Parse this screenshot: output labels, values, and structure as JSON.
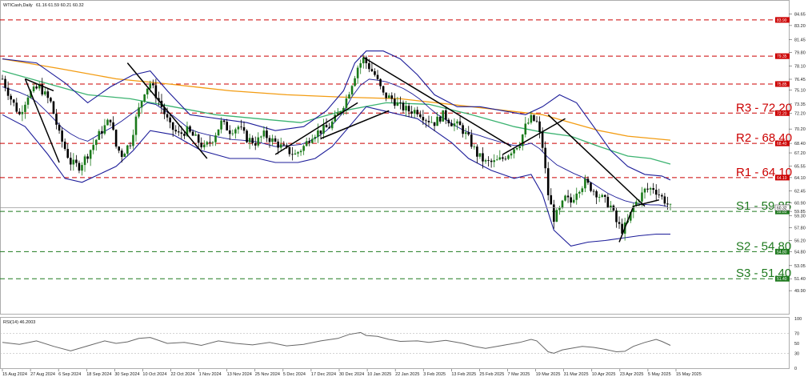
{
  "header": {
    "symbol": "WTICash,Daily",
    "ohlc": "61.16 61.59 60.21 60.32"
  },
  "rsi_header": "RSI(14) 46.2003",
  "colors": {
    "resistance": "#cc0000",
    "support": "#1f7a1f",
    "bull_candle": "#1a7a1a",
    "bear_candle": "#000000",
    "bollinger": "#1c1c99",
    "ma_fast": "#3cb371",
    "ma_slow": "#f39c12",
    "trendline": "#000000",
    "rsi_line": "#666666"
  },
  "chart_data": [
    {
      "type": "candlestick",
      "title": "",
      "xlabel": "",
      "ylabel": "",
      "ylim": [
        47.0,
        86.0
      ],
      "grid": false,
      "levels": [
        {
          "label": "R3 - 72.20",
          "value": 72.2,
          "kind": "resistance"
        },
        {
          "label": "R2 - 68.40",
          "value": 68.4,
          "kind": "resistance"
        },
        {
          "label": "R1 - 64.10",
          "value": 64.1,
          "kind": "resistance"
        },
        {
          "label": "S1 - 59.85",
          "value": 59.85,
          "kind": "support"
        },
        {
          "label": "S2 - 54.80",
          "value": 54.8,
          "kind": "support"
        },
        {
          "label": "S3 - 51.40",
          "value": 51.4,
          "kind": "support"
        }
      ],
      "extra_lines": [
        {
          "value": 83.9,
          "kind": "resistance"
        },
        {
          "value": 79.35,
          "kind": "resistance"
        },
        {
          "value": 75.85,
          "kind": "resistance"
        }
      ],
      "current_price": 60.32,
      "y_ticks": [
        "84.65",
        "83.20",
        "81.45",
        "79.80",
        "78.10",
        "76.45",
        "75.10",
        "73.35",
        "72.20",
        "70.20",
        "68.40",
        "67.20",
        "65.55",
        "64.10",
        "62.45",
        "60.90",
        "59.85",
        "59.30",
        "57.80",
        "56.20",
        "54.80",
        "53.05",
        "51.40",
        "49.90"
      ],
      "x_ticks": [
        "15 Aug 2024",
        "27 Aug 2024",
        "6 Sep 2024",
        "18 Sep 2024",
        "30 Sep 2024",
        "10 Oct 2024",
        "22 Oct 2024",
        "1 Nov 2024",
        "13 Nov 2024",
        "25 Nov 2024",
        "5 Dec 2024",
        "17 Dec 2024",
        "30 Dec 2024",
        "10 Jan 2025",
        "22 Jan 2025",
        "3 Feb 2025",
        "13 Feb 2025",
        "25 Feb 2025",
        "7 Mar 2025",
        "19 Mar 2025",
        "31 Mar 2025",
        "10 Apr 2025",
        "23 Apr 2025",
        "5 May 2025",
        "15 May 2025"
      ],
      "close_path": [
        [
          0,
          76.5
        ],
        [
          3,
          74.0
        ],
        [
          6,
          72.0
        ],
        [
          9,
          74.5
        ],
        [
          13,
          75.5
        ],
        [
          17,
          73.5
        ],
        [
          20,
          69.5
        ],
        [
          24,
          66.0
        ],
        [
          27,
          65.5
        ],
        [
          30,
          67.0
        ],
        [
          34,
          69.5
        ],
        [
          38,
          71.5
        ],
        [
          40,
          68.0
        ],
        [
          42,
          67.0
        ],
        [
          45,
          68.5
        ],
        [
          47,
          71.5
        ],
        [
          50,
          75.0
        ],
        [
          52,
          76.0
        ],
        [
          54,
          74.5
        ],
        [
          56,
          73.0
        ],
        [
          59,
          70.5
        ],
        [
          62,
          69.5
        ],
        [
          65,
          70.0
        ],
        [
          68,
          69.0
        ],
        [
          71,
          67.8
        ],
        [
          74,
          69.0
        ],
        [
          77,
          71.0
        ],
        [
          80,
          70.0
        ],
        [
          83,
          70.5
        ],
        [
          86,
          69.0
        ],
        [
          89,
          68.5
        ],
        [
          92,
          69.5
        ],
        [
          96,
          68.5
        ],
        [
          100,
          67.5
        ],
        [
          103,
          67.0
        ],
        [
          106,
          68.0
        ],
        [
          109,
          69.5
        ],
        [
          112,
          70.0
        ],
        [
          115,
          70.5
        ],
        [
          118,
          72.0
        ],
        [
          121,
          74.0
        ],
        [
          123,
          76.0
        ],
        [
          125,
          78.0
        ],
        [
          127,
          79.0
        ],
        [
          129,
          78.0
        ],
        [
          131,
          77.0
        ],
        [
          134,
          74.5
        ],
        [
          137,
          74.0
        ],
        [
          140,
          73.0
        ],
        [
          143,
          72.5
        ],
        [
          146,
          72.5
        ],
        [
          149,
          71.5
        ],
        [
          152,
          71.0
        ],
        [
          155,
          72.0
        ],
        [
          158,
          71.0
        ],
        [
          161,
          70.5
        ],
        [
          164,
          69.0
        ],
        [
          167,
          67.0
        ],
        [
          170,
          66.0
        ],
        [
          173,
          66.0
        ],
        [
          176,
          66.5
        ],
        [
          179,
          67.5
        ],
        [
          182,
          68.5
        ],
        [
          184,
          70.5
        ],
        [
          186,
          71.5
        ],
        [
          188,
          71.0
        ],
        [
          190,
          68.0
        ],
        [
          192,
          62.0
        ],
        [
          194,
          59.0
        ],
        [
          196,
          60.0
        ],
        [
          198,
          61.5
        ],
        [
          200,
          61.0
        ],
        [
          202,
          62.5
        ],
        [
          205,
          63.5
        ],
        [
          208,
          62.5
        ],
        [
          211,
          61.5
        ],
        [
          214,
          60.5
        ],
        [
          216,
          58.5
        ],
        [
          218,
          57.5
        ],
        [
          220,
          58.5
        ],
        [
          222,
          60.5
        ],
        [
          224,
          61.5
        ],
        [
          226,
          62.5
        ],
        [
          229,
          62.8
        ],
        [
          231,
          62.0
        ],
        [
          233,
          61.2
        ],
        [
          235,
          60.32
        ]
      ],
      "bb_upper": [
        [
          0,
          79.0
        ],
        [
          12,
          78.5
        ],
        [
          22,
          76.0
        ],
        [
          30,
          73.5
        ],
        [
          38,
          75.5
        ],
        [
          46,
          77.0
        ],
        [
          52,
          77.5
        ],
        [
          58,
          75.0
        ],
        [
          66,
          72.0
        ],
        [
          76,
          71.5
        ],
        [
          86,
          71.0
        ],
        [
          96,
          70.0
        ],
        [
          106,
          70.5
        ],
        [
          114,
          72.5
        ],
        [
          120,
          75.0
        ],
        [
          124,
          78.5
        ],
        [
          128,
          80.0
        ],
        [
          134,
          80.0
        ],
        [
          140,
          79.0
        ],
        [
          146,
          77.0
        ],
        [
          152,
          74.5
        ],
        [
          160,
          73.0
        ],
        [
          168,
          73.0
        ],
        [
          176,
          72.5
        ],
        [
          184,
          72.0
        ],
        [
          190,
          73.0
        ],
        [
          196,
          74.5
        ],
        [
          202,
          73.5
        ],
        [
          208,
          70.5
        ],
        [
          214,
          67.5
        ],
        [
          220,
          65.5
        ],
        [
          226,
          64.5
        ],
        [
          232,
          64.3
        ],
        [
          235,
          63.8
        ]
      ],
      "bb_lower": [
        [
          0,
          72.0
        ],
        [
          8,
          70.5
        ],
        [
          16,
          67.0
        ],
        [
          22,
          64.0
        ],
        [
          28,
          63.5
        ],
        [
          34,
          64.5
        ],
        [
          40,
          65.5
        ],
        [
          46,
          67.5
        ],
        [
          52,
          70.0
        ],
        [
          60,
          69.5
        ],
        [
          70,
          67.5
        ],
        [
          80,
          66.5
        ],
        [
          90,
          66.5
        ],
        [
          96,
          66.0
        ],
        [
          104,
          66.0
        ],
        [
          110,
          66.5
        ],
        [
          116,
          68.0
        ],
        [
          122,
          70.5
        ],
        [
          128,
          73.0
        ],
        [
          134,
          72.5
        ],
        [
          140,
          72.0
        ],
        [
          146,
          71.5
        ],
        [
          152,
          70.0
        ],
        [
          158,
          68.5
        ],
        [
          164,
          66.5
        ],
        [
          172,
          65.0
        ],
        [
          180,
          64.0
        ],
        [
          186,
          64.5
        ],
        [
          190,
          62.0
        ],
        [
          194,
          57.5
        ],
        [
          200,
          55.5
        ],
        [
          206,
          56.0
        ],
        [
          212,
          56.2
        ],
        [
          218,
          56.5
        ],
        [
          224,
          56.8
        ],
        [
          230,
          57.0
        ],
        [
          235,
          57.0
        ]
      ],
      "ma_fast": [
        [
          0,
          77.5
        ],
        [
          15,
          76.0
        ],
        [
          30,
          74.5
        ],
        [
          45,
          74.0
        ],
        [
          60,
          73.0
        ],
        [
          75,
          72.0
        ],
        [
          90,
          71.5
        ],
        [
          105,
          71.0
        ],
        [
          120,
          72.5
        ],
        [
          135,
          73.5
        ],
        [
          150,
          73.3
        ],
        [
          165,
          72.0
        ],
        [
          180,
          70.5
        ],
        [
          190,
          69.8
        ],
        [
          200,
          69.3
        ],
        [
          210,
          68.0
        ],
        [
          220,
          66.8
        ],
        [
          228,
          66.5
        ],
        [
          235,
          65.8
        ]
      ],
      "ma_slow": [
        [
          0,
          79.0
        ],
        [
          20,
          77.8
        ],
        [
          40,
          76.5
        ],
        [
          60,
          75.8
        ],
        [
          80,
          75.0
        ],
        [
          100,
          74.5
        ],
        [
          120,
          74.2
        ],
        [
          140,
          74.0
        ],
        [
          160,
          73.2
        ],
        [
          175,
          72.6
        ],
        [
          190,
          72.0
        ],
        [
          200,
          71.0
        ],
        [
          210,
          70.0
        ],
        [
          220,
          69.3
        ],
        [
          235,
          68.8
        ]
      ],
      "trendlines": [
        [
          [
            8,
            76.5
          ],
          [
            20,
            66.0
          ]
        ],
        [
          [
            8,
            76.5
          ],
          [
            18,
            75.0
          ]
        ],
        [
          [
            44,
            78.5
          ],
          [
            72,
            66.5
          ]
        ],
        [
          [
            96,
            67.0
          ],
          [
            125,
            73.5
          ]
        ],
        [
          [
            112,
            69.0
          ],
          [
            136,
            72.5
          ]
        ],
        [
          [
            127,
            79.2
          ],
          [
            179,
            68.0
          ]
        ],
        [
          [
            176,
            67.0
          ],
          [
            198,
            71.5
          ]
        ],
        [
          [
            192,
            72.0
          ],
          [
            226,
            60.5
          ]
        ],
        [
          [
            217,
            56.0
          ],
          [
            222,
            60.5
          ]
        ],
        [
          [
            222,
            60.5
          ],
          [
            231,
            61.3
          ]
        ]
      ]
    },
    {
      "type": "line",
      "name": "RSI",
      "ylim": [
        0,
        100
      ],
      "y_ticks": [
        "100",
        "70",
        "50",
        "30",
        "0"
      ],
      "rsi_path": [
        [
          0,
          52
        ],
        [
          6,
          48
        ],
        [
          12,
          55
        ],
        [
          18,
          44
        ],
        [
          24,
          35
        ],
        [
          30,
          45
        ],
        [
          36,
          55
        ],
        [
          40,
          50
        ],
        [
          44,
          53
        ],
        [
          48,
          60
        ],
        [
          52,
          62
        ],
        [
          58,
          50
        ],
        [
          64,
          52
        ],
        [
          70,
          46
        ],
        [
          76,
          55
        ],
        [
          82,
          50
        ],
        [
          88,
          47
        ],
        [
          94,
          52
        ],
        [
          100,
          45
        ],
        [
          106,
          48
        ],
        [
          112,
          55
        ],
        [
          118,
          60
        ],
        [
          122,
          68
        ],
        [
          126,
          72
        ],
        [
          128,
          66
        ],
        [
          132,
          64
        ],
        [
          136,
          58
        ],
        [
          140,
          54
        ],
        [
          146,
          55
        ],
        [
          150,
          52
        ],
        [
          156,
          56
        ],
        [
          162,
          50
        ],
        [
          166,
          44
        ],
        [
          170,
          40
        ],
        [
          176,
          46
        ],
        [
          182,
          52
        ],
        [
          186,
          58
        ],
        [
          188,
          55
        ],
        [
          190,
          44
        ],
        [
          192,
          33
        ],
        [
          194,
          30
        ],
        [
          197,
          37
        ],
        [
          200,
          40
        ],
        [
          204,
          44
        ],
        [
          208,
          42
        ],
        [
          212,
          38
        ],
        [
          216,
          33
        ],
        [
          219,
          34
        ],
        [
          222,
          44
        ],
        [
          226,
          52
        ],
        [
          230,
          58
        ],
        [
          232,
          54
        ],
        [
          235,
          46
        ]
      ]
    }
  ]
}
